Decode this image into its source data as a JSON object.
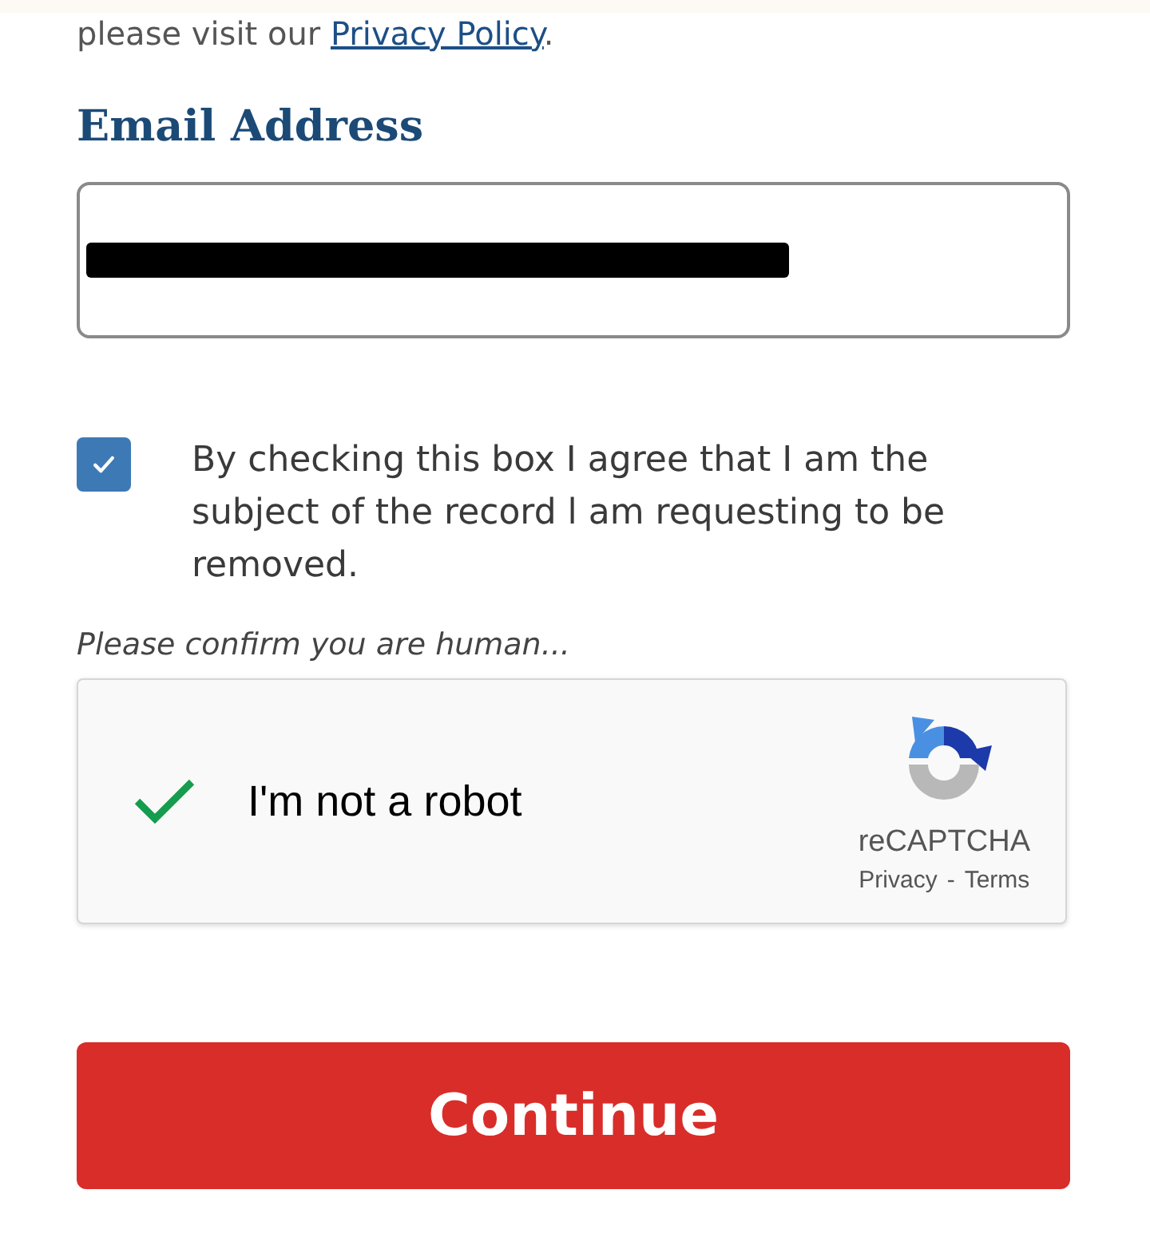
{
  "intro": {
    "text": "please visit our ",
    "link": "Privacy Policy",
    "end": "."
  },
  "email": {
    "label": "Email Address",
    "redacted": true
  },
  "consent": {
    "checked": true,
    "text": "By checking this box I agree that I am the subject of the record l am requesting to be removed."
  },
  "captcha": {
    "hint": "Please confirm you are human...",
    "checked": true,
    "label": "I'm not a robot",
    "brand": "reCAPTCHA",
    "privacy": "Privacy",
    "separator": "-",
    "terms": "Terms"
  },
  "submit": {
    "label": "Continue"
  }
}
